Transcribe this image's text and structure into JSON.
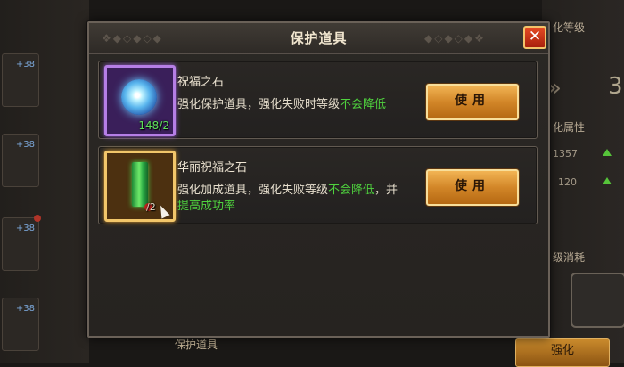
{
  "background": {
    "right_header": "化等级",
    "right_attr_label": "化属性",
    "right_consume_label": "级消耗",
    "right_value_1": "1357",
    "right_value_2": "120",
    "big_number": "3",
    "left_slot_level": "+38",
    "bottom_label": "保护道具",
    "bottom_button": "强化"
  },
  "dialog": {
    "title": "保护道具",
    "close_label": "✕",
    "items": [
      {
        "name": "祝福之石",
        "count": "148/2",
        "desc_plain": "强化保护道具，强化失败时等级",
        "desc_highlight": "不会降低",
        "use_label": "使用"
      },
      {
        "name": "华丽祝福之石",
        "count": "/2",
        "desc_plain": "强化加成道具，强化失败等级",
        "desc_highlight": "不会降低",
        "desc_plain2": "，并",
        "desc_highlight2": "提高成功率",
        "use_label": "使用"
      }
    ]
  },
  "colors": {
    "highlight_green": "#4fd23e",
    "button_gold": "#d28628",
    "purple_frame": "#b57ee6",
    "orange_frame": "#f2c66a"
  }
}
